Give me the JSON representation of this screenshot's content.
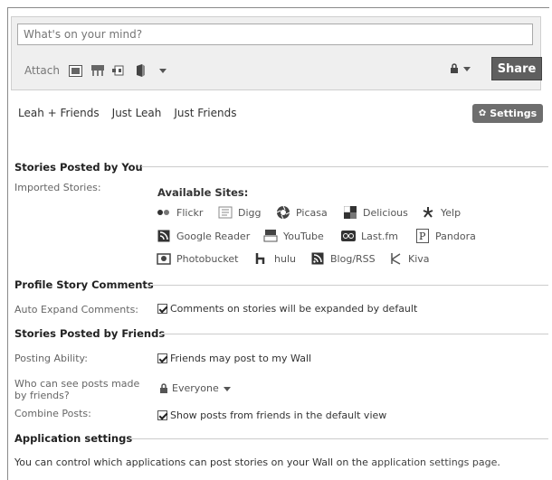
{
  "publisher": {
    "placeholder": "What's on your mind?",
    "attach_label": "Attach",
    "share_label": "Share",
    "attachments": [
      "photo-icon",
      "event-icon",
      "video-icon",
      "note-icon"
    ]
  },
  "filters": {
    "tabs": [
      "Leah + Friends",
      "Just Leah",
      "Just Friends"
    ],
    "settings_label": "Settings"
  },
  "stories_by_you": {
    "heading": "Stories Posted by You",
    "imported_label": "Imported Stories:",
    "available_title": "Available Sites:",
    "sites": [
      "Flickr",
      "Digg",
      "Picasa",
      "Delicious",
      "Yelp",
      "Google Reader",
      "YouTube",
      "Last.fm",
      "Pandora",
      "Photobucket",
      "hulu",
      "Blog/RSS",
      "Kiva"
    ]
  },
  "comments": {
    "heading": "Profile Story Comments",
    "label": "Auto Expand Comments:",
    "option": "Comments on stories will be expanded by default"
  },
  "by_friends": {
    "heading": "Stories Posted by Friends",
    "posting_label": "Posting Ability:",
    "posting_option": "Friends may post to my Wall",
    "who_label_line1": "Who can see posts made",
    "who_label_line2": "by friends?",
    "who_value": "Everyone",
    "combine_label": "Combine Posts:",
    "combine_option": "Show posts from friends in the default view"
  },
  "app_settings": {
    "heading": "Application settings",
    "text_before": "You can control which applications can post stories on your Wall on the ",
    "link": "application settings page",
    "text_after": "."
  }
}
